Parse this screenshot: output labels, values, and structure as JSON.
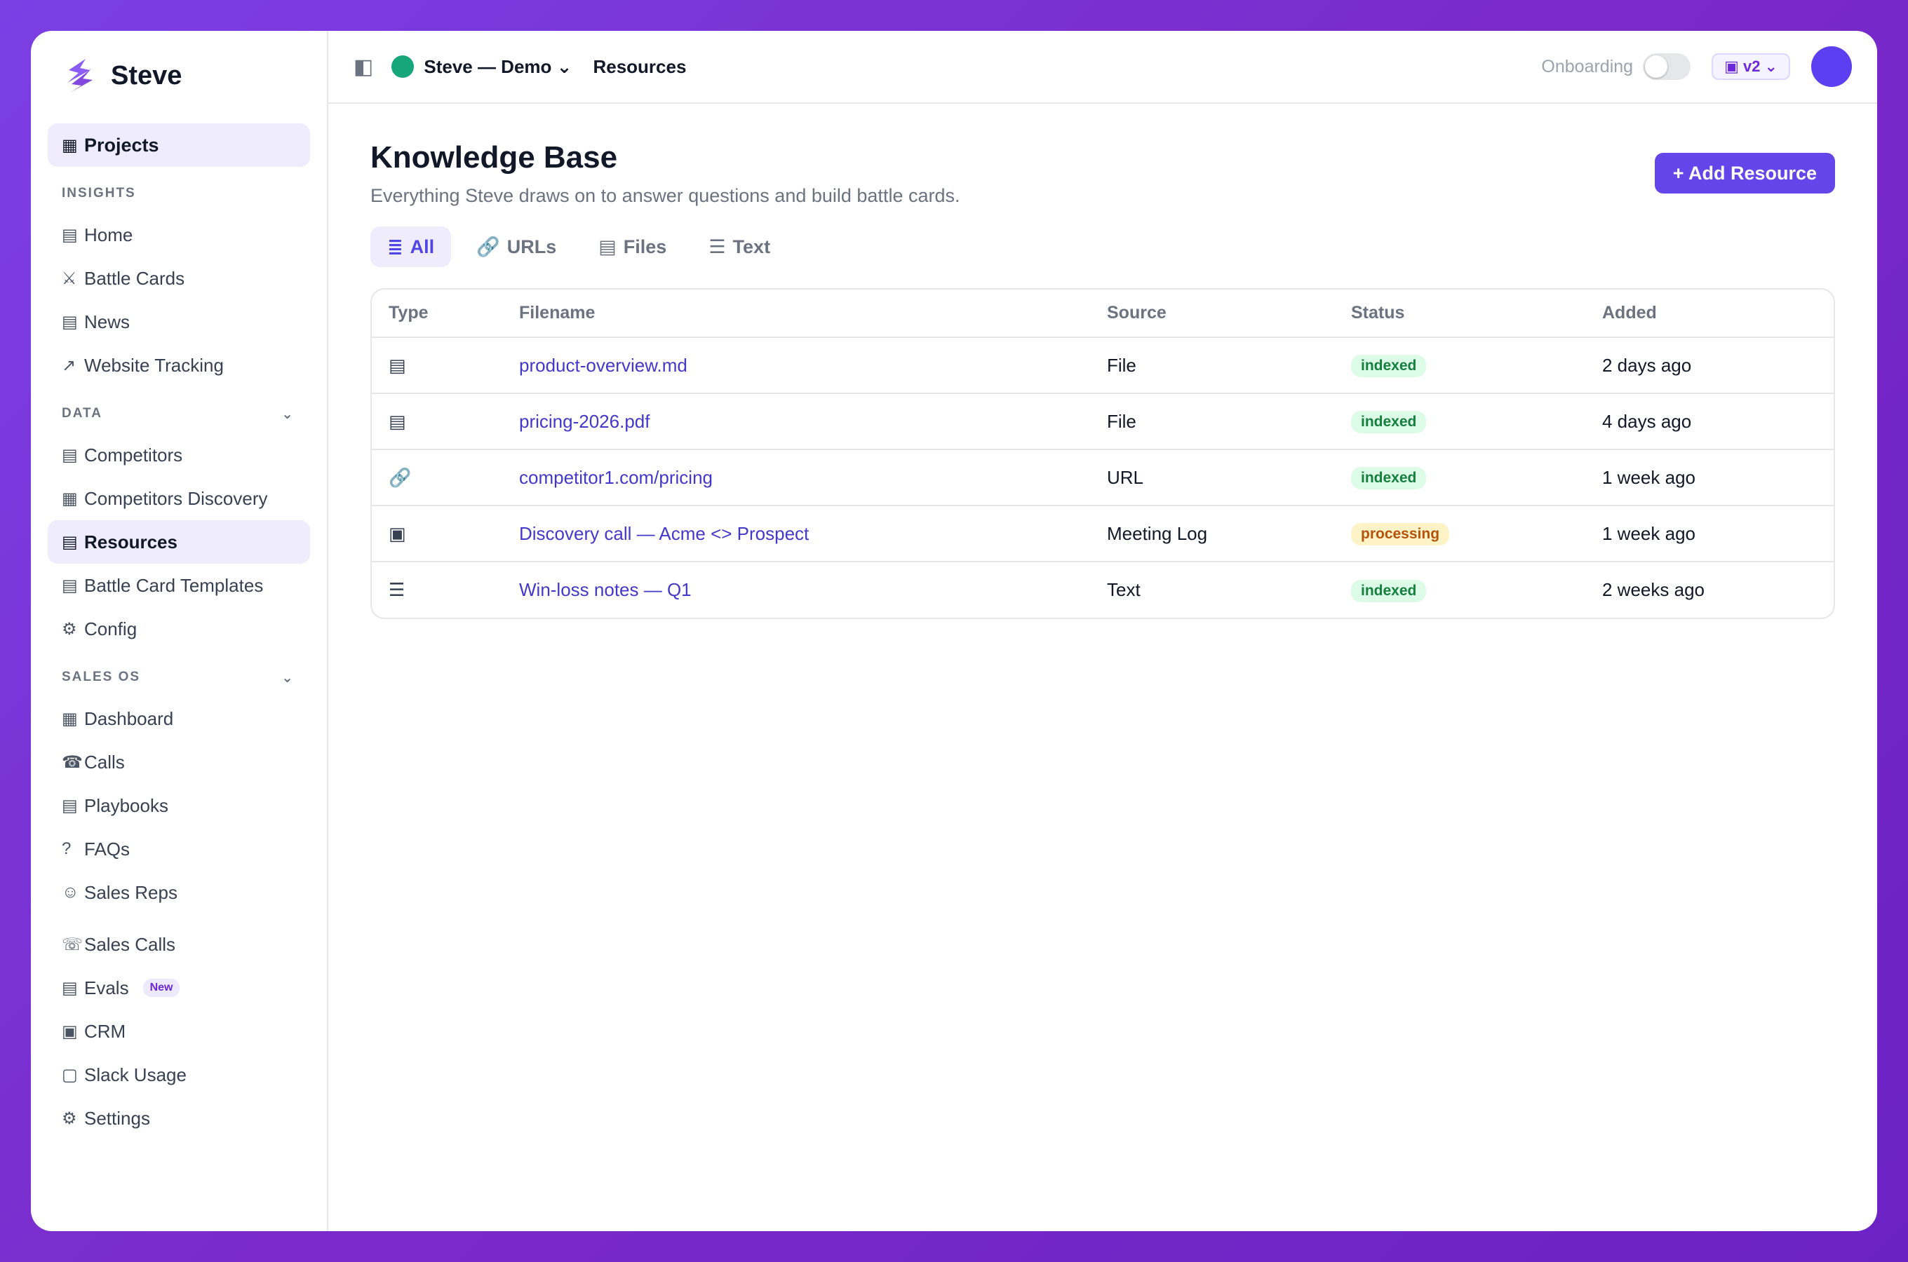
{
  "app": {
    "brand": "Steve",
    "project_name": "Steve — Demo",
    "project_chevron": "⌄",
    "breadcrumb": "Resources",
    "onboarding_label": "Onboarding",
    "version_label": "▣ v2 ⌄"
  },
  "sidebar": {
    "projects": {
      "icon": "▦",
      "label": "Projects"
    },
    "sections": [
      {
        "title": "INSIGHTS",
        "chevron": "",
        "items": [
          {
            "icon": "▤",
            "label": "Home"
          },
          {
            "icon": "⚔",
            "label": "Battle Cards"
          },
          {
            "icon": "▤",
            "label": "News"
          },
          {
            "icon": "↗",
            "label": "Website Tracking"
          }
        ]
      },
      {
        "title": "DATA",
        "chevron": "⌄",
        "items": [
          {
            "icon": "▤",
            "label": "Competitors"
          },
          {
            "icon": "▦",
            "label": "Competitors Discovery"
          },
          {
            "icon": "▤",
            "label": "Resources"
          },
          {
            "icon": "▤",
            "label": "Battle Card Templates"
          },
          {
            "icon": "⚙",
            "label": "Config"
          }
        ]
      },
      {
        "title": "SALES OS",
        "chevron": "⌄",
        "items": [
          {
            "icon": "▦",
            "label": "Dashboard"
          },
          {
            "icon": "☎",
            "label": "Calls"
          },
          {
            "icon": "▤",
            "label": "Playbooks"
          },
          {
            "icon": "?",
            "label": "FAQs"
          },
          {
            "icon": "☺",
            "label": "Sales Reps"
          }
        ]
      }
    ],
    "extra_items": [
      {
        "icon": "☏",
        "label": "Sales Calls"
      },
      {
        "icon": "▤",
        "label": "Evals",
        "badge": "New"
      },
      {
        "icon": "▣",
        "label": "CRM"
      },
      {
        "icon": "▢",
        "label": "Slack Usage"
      },
      {
        "icon": "⚙",
        "label": "Settings"
      }
    ]
  },
  "page": {
    "title": "Knowledge Base",
    "subtitle": "Everything Steve draws on to answer questions and build battle cards.",
    "add_button": "+ Add Resource",
    "tabs": [
      {
        "icon": "≣",
        "label": "All"
      },
      {
        "icon": "🔗",
        "label": "URLs"
      },
      {
        "icon": "▤",
        "label": "Files"
      },
      {
        "icon": "☰",
        "label": "Text"
      }
    ]
  },
  "table": {
    "columns": [
      "Type",
      "Filename",
      "Source",
      "Status",
      "Added"
    ],
    "rows": [
      {
        "type_icon": "▤",
        "filename": "product-overview.md",
        "source": "File",
        "status": "indexed",
        "added": "2 days ago"
      },
      {
        "type_icon": "▤",
        "filename": "pricing-2026.pdf",
        "source": "File",
        "status": "indexed",
        "added": "4 days ago"
      },
      {
        "type_icon": "🔗",
        "filename": "competitor1.com/pricing",
        "source": "URL",
        "status": "indexed",
        "added": "1 week ago"
      },
      {
        "type_icon": "▣",
        "filename": "Discovery call — Acme <> Prospect",
        "source": "Meeting Log",
        "status": "processing",
        "added": "1 week ago"
      },
      {
        "type_icon": "☰",
        "filename": "Win-loss notes — Q1",
        "source": "Text",
        "status": "indexed",
        "added": "2 weeks ago"
      }
    ]
  },
  "colors": {
    "accent": "#6246ea",
    "background_gradient_start": "#7b3fe4",
    "indexed": "#15803d",
    "processing": "#b45309",
    "project_dot": "#16a67a"
  }
}
